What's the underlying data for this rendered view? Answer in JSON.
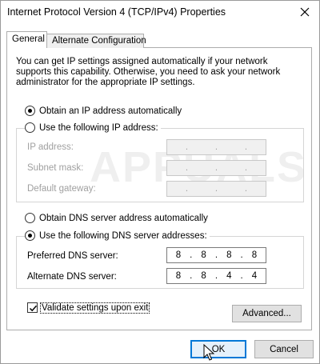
{
  "window": {
    "title": "Internet Protocol Version 4 (TCP/IPv4) Properties"
  },
  "tabs": [
    {
      "label": "General",
      "active": true
    },
    {
      "label": "Alternate Configuration",
      "active": false
    }
  ],
  "general": {
    "description": "You can get IP settings assigned automatically if your network supports this capability. Otherwise, you need to ask your network administrator for the appropriate IP settings.",
    "ip_options": {
      "auto_label": "Obtain an IP address automatically",
      "manual_label": "Use the following IP address:",
      "selected": "auto"
    },
    "ip_fields": [
      {
        "label": "IP address:",
        "value": [
          ".",
          ".",
          "."
        ]
      },
      {
        "label": "Subnet mask:",
        "value": [
          ".",
          ".",
          "."
        ]
      },
      {
        "label": "Default gateway:",
        "value": [
          ".",
          ".",
          "."
        ]
      }
    ],
    "dns_options": {
      "auto_label": "Obtain DNS server address automatically",
      "manual_label": "Use the following DNS server addresses:",
      "selected": "manual"
    },
    "dns_fields": {
      "preferred": {
        "label": "Preferred DNS server:",
        "octets": [
          "8",
          "8",
          "8",
          "8"
        ]
      },
      "alternate": {
        "label": "Alternate DNS server:",
        "octets": [
          "8",
          "8",
          "4",
          "4"
        ]
      }
    },
    "validate": {
      "label": "Validate settings upon exit",
      "checked": true
    },
    "advanced_label": "Advanced..."
  },
  "footer": {
    "ok_label": "OK",
    "cancel_label": "Cancel"
  },
  "watermark": "APPUALS",
  "colors": {
    "accent": "#0078d7",
    "disabled_text": "#a0a0a0",
    "button_bg": "#e1e1e1"
  }
}
